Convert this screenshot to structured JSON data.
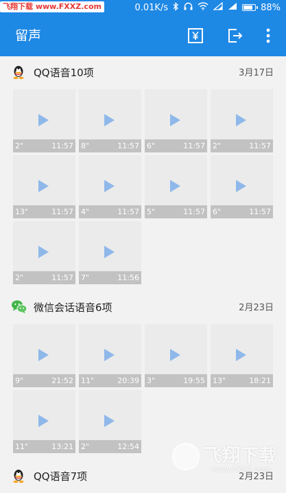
{
  "status_bar": {
    "watermark": "飞翔下载 www.FXXZ.com",
    "speed": "0.01K/s",
    "battery": "88%",
    "battery_level": 0.88
  },
  "app_bar": {
    "title": "留声",
    "icons": [
      "yen-icon",
      "logout-icon",
      "more-vert-icon"
    ]
  },
  "sections": [
    {
      "icon": "qq-icon",
      "title": "QQ语音10项",
      "date": "3月17日",
      "items": [
        {
          "duration": "2\"",
          "time": "11:57"
        },
        {
          "duration": "8\"",
          "time": "11:57"
        },
        {
          "duration": "6\"",
          "time": "11:57"
        },
        {
          "duration": "2\"",
          "time": "11:57"
        },
        {
          "duration": "13\"",
          "time": "11:57"
        },
        {
          "duration": "4\"",
          "time": "11:57"
        },
        {
          "duration": "5\"",
          "time": "11:57"
        },
        {
          "duration": "6\"",
          "time": "11:57"
        },
        {
          "duration": "2\"",
          "time": "11:57"
        },
        {
          "duration": "7\"",
          "time": "11:56"
        }
      ]
    },
    {
      "icon": "wechat-icon",
      "title": "微信会话语音6项",
      "date": "2月23日",
      "items": [
        {
          "duration": "9\"",
          "time": "21:52"
        },
        {
          "duration": "11\"",
          "time": "20:39"
        },
        {
          "duration": "3\"",
          "time": "19:55"
        },
        {
          "duration": "13\"",
          "time": "18:21"
        },
        {
          "duration": "11\"",
          "time": "13:21"
        },
        {
          "duration": "2\"",
          "time": "12:54"
        }
      ]
    },
    {
      "icon": "qq-icon",
      "title": "QQ语音7项",
      "date": "2月23日",
      "items": []
    }
  ],
  "watermark_bottom": {
    "title": "飞翔下载",
    "url": "www.FXXZ.com"
  },
  "colors": {
    "primary": "#1e88e5",
    "tile_bg": "#ebebeb",
    "tile_bar": "#c2c2c2",
    "play": "#8fb8ea"
  }
}
